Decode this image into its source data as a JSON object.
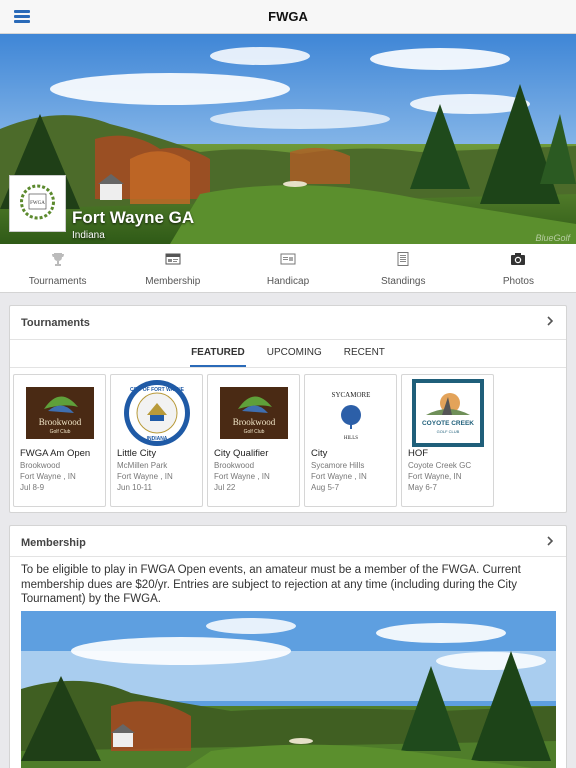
{
  "app": {
    "title": "FWGA"
  },
  "hero": {
    "name": "Fort Wayne GA",
    "state": "Indiana",
    "watermark": "BlueGolf",
    "logo_text": "FWGA"
  },
  "nav": [
    {
      "label": "Tournaments",
      "icon": "trophy-icon"
    },
    {
      "label": "Membership",
      "icon": "member-card-icon"
    },
    {
      "label": "Handicap",
      "icon": "handicap-card-icon"
    },
    {
      "label": "Standings",
      "icon": "standings-list-icon"
    },
    {
      "label": "Photos",
      "icon": "camera-icon"
    }
  ],
  "tournaments": {
    "title": "Tournaments",
    "tabs": [
      "FEATURED",
      "UPCOMING",
      "RECENT"
    ],
    "active_tab": "FEATURED",
    "items": [
      {
        "name": "FWGA Am Open",
        "course": "Brookwood",
        "city": "Fort Wayne , IN",
        "date": "Jul 8-9",
        "logo": "brookwood"
      },
      {
        "name": "Little City",
        "course": "McMillen Park",
        "city": "Fort Wayne , IN",
        "date": "Jun 10-11",
        "logo": "city-seal"
      },
      {
        "name": "City Qualifier",
        "course": "Brookwood",
        "city": "Fort Wayne , IN",
        "date": "Jul 22",
        "logo": "brookwood"
      },
      {
        "name": "City",
        "course": "Sycamore Hills",
        "city": "Fort Wayne , IN",
        "date": "Aug 5-7",
        "logo": "sycamore"
      },
      {
        "name": "HOF",
        "course": "Coyote Creek GC",
        "city": "Fort Wayne, IN",
        "date": "May 6-7",
        "logo": "coyote"
      }
    ],
    "logo_text": {
      "brookwood": "Brookwood",
      "brookwood_sub": "Golf Club",
      "seal_top": "CITY OF FORT WAYNE",
      "seal_bottom": "INDIANA",
      "sycamore_top": "SYCAMORE",
      "sycamore_bottom": "HILLS",
      "coyote": "COYOTE CREEK",
      "coyote_sub": "GOLF CLUB"
    }
  },
  "membership": {
    "title": "Membership",
    "text": "To be eligible to play in FWGA Open events, an amateur must be a member of the FWGA. Current membership dues are $20/yr. Entries are subject to rejection at any time (including during the City Tournament) by the FWGA."
  },
  "colors": {
    "accent": "#2a6ab8",
    "page_bg": "#e9e9ec"
  }
}
